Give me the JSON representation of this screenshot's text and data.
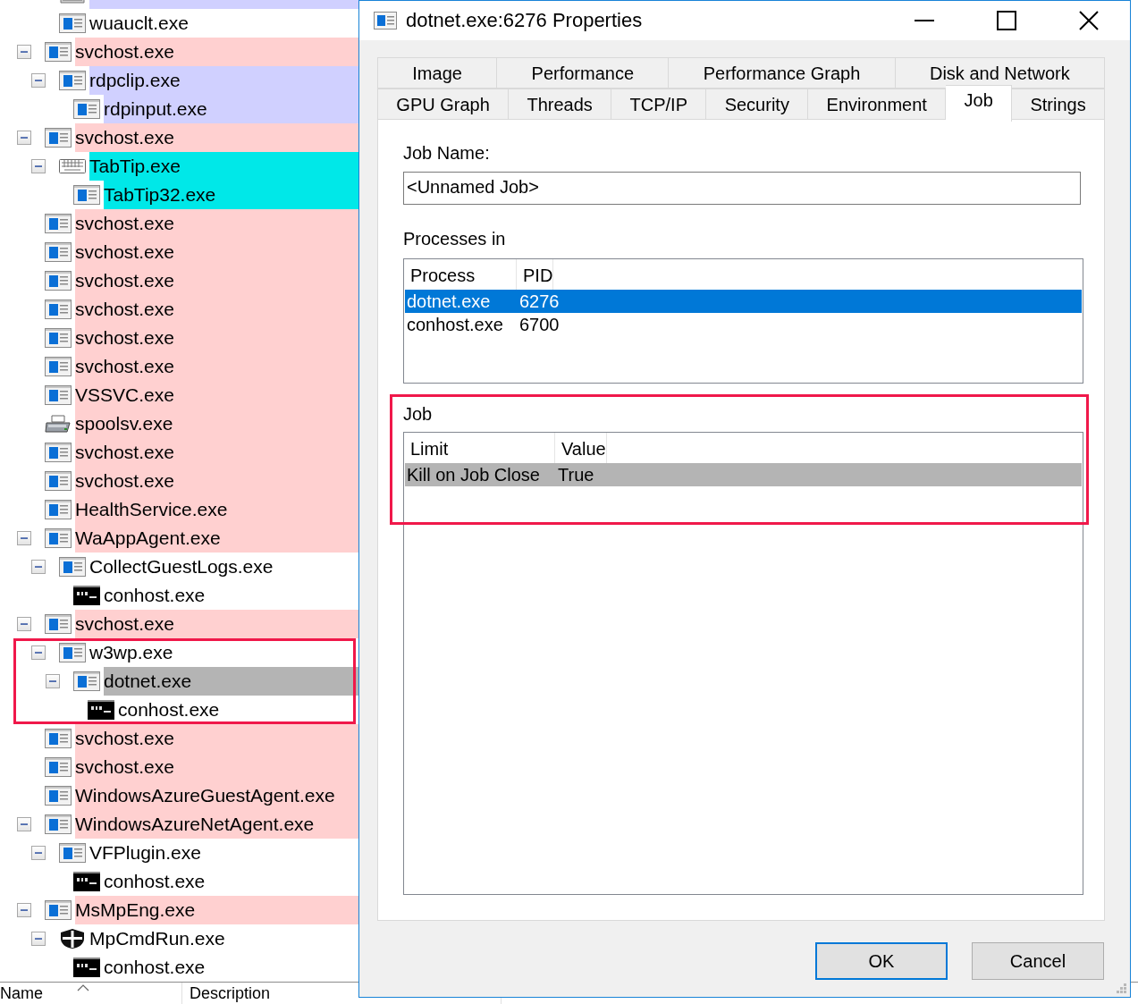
{
  "process_tree": [
    {
      "children": [
        {
          "kind": "drive",
          "color": "#d0d0ff",
          "selected": false
        },
        {
          "name": "wuauclt.exe",
          "kind": "window",
          "selected": false
        }
      ]
    },
    {
      "name": "svchost.exe",
      "kind": "window",
      "color": "#ffd0d0",
      "selected": false,
      "expanded": true,
      "children": [
        {
          "name": "rdpclip.exe",
          "kind": "window",
          "color": "#d0d0ff",
          "selected": false,
          "expanded": true,
          "children": [
            {
              "name": "rdpinput.exe",
              "kind": "window",
              "color": "#d0d0ff",
              "selected": false
            }
          ]
        }
      ]
    },
    {
      "name": "svchost.exe",
      "kind": "window",
      "color": "#ffd0d0",
      "selected": false,
      "expanded": true,
      "children": [
        {
          "name": "TabTip.exe",
          "kind": "keyboard",
          "color": "#00e8e8",
          "selected": false,
          "expanded": true,
          "children": [
            {
              "name": "TabTip32.exe",
              "kind": "window",
              "color": "#00e8e8",
              "selected": false
            }
          ]
        }
      ]
    },
    {
      "name": "svchost.exe",
      "kind": "window",
      "color": "#ffd0d0",
      "selected": false
    },
    {
      "name": "svchost.exe",
      "kind": "window",
      "color": "#ffd0d0",
      "selected": false
    },
    {
      "name": "svchost.exe",
      "kind": "window",
      "color": "#ffd0d0",
      "selected": false
    },
    {
      "name": "svchost.exe",
      "kind": "window",
      "color": "#ffd0d0",
      "selected": false
    },
    {
      "name": "svchost.exe",
      "kind": "window",
      "color": "#ffd0d0",
      "selected": false
    },
    {
      "name": "svchost.exe",
      "kind": "window",
      "color": "#ffd0d0",
      "selected": false
    },
    {
      "name": "VSSVC.exe",
      "kind": "window",
      "color": "#ffd0d0",
      "selected": false
    },
    {
      "name": "spoolsv.exe",
      "kind": "printer",
      "color": "#ffd0d0",
      "selected": false
    },
    {
      "name": "svchost.exe",
      "kind": "window",
      "color": "#ffd0d0",
      "selected": false
    },
    {
      "name": "svchost.exe",
      "kind": "window",
      "color": "#ffd0d0",
      "selected": false
    },
    {
      "name": "HealthService.exe",
      "kind": "window",
      "color": "#ffd0d0",
      "selected": false
    },
    {
      "name": "WaAppAgent.exe",
      "kind": "window",
      "color": "#ffd0d0",
      "selected": false,
      "expanded": true,
      "children": [
        {
          "name": "CollectGuestLogs.exe",
          "kind": "window",
          "selected": false,
          "expanded": true,
          "children": [
            {
              "name": "conhost.exe",
              "kind": "console",
              "selected": false
            }
          ]
        }
      ]
    },
    {
      "name": "svchost.exe",
      "kind": "window",
      "color": "#ffd0d0",
      "selected": false,
      "expanded": true,
      "children": [
        {
          "name": "w3wp.exe",
          "kind": "window",
          "selected": false,
          "expanded": true,
          "highlighted": true,
          "children": [
            {
              "name": "dotnet.exe",
              "kind": "window",
              "selected": true,
              "expanded": true,
              "children": [
                {
                  "name": "conhost.exe",
                  "kind": "console",
                  "selected": false
                }
              ]
            }
          ]
        }
      ]
    },
    {
      "name": "svchost.exe",
      "kind": "window",
      "color": "#ffd0d0",
      "selected": false
    },
    {
      "name": "svchost.exe",
      "kind": "window",
      "color": "#ffd0d0",
      "selected": false
    },
    {
      "name": "WindowsAzureGuestAgent.exe",
      "kind": "window",
      "color": "#ffd0d0",
      "selected": false
    },
    {
      "name": "WindowsAzureNetAgent.exe",
      "kind": "window",
      "color": "#ffd0d0",
      "selected": false,
      "expanded": true,
      "children": [
        {
          "name": "VFPlugin.exe",
          "kind": "window",
          "selected": false,
          "expanded": true,
          "children": [
            {
              "name": "conhost.exe",
              "kind": "console",
              "selected": false
            }
          ]
        }
      ]
    },
    {
      "name": "MsMpEng.exe",
      "kind": "window",
      "color": "#ffd0d0",
      "selected": false,
      "expanded": true,
      "children": [
        {
          "name": "MpCmdRun.exe",
          "kind": "shield",
          "selected": false,
          "expanded": true,
          "children": [
            {
              "name": "conhost.exe",
              "kind": "console",
              "selected": false
            }
          ]
        }
      ]
    }
  ],
  "columns": [
    {
      "label": "Name",
      "sorted": true
    },
    {
      "label": "Description",
      "sorted": false
    }
  ],
  "dialog": {
    "title": "dotnet.exe:6276 Properties",
    "tab_rows": [
      [
        {
          "label": "Image",
          "selected": false
        },
        {
          "label": "Performance",
          "selected": false
        },
        {
          "label": "Performance Graph",
          "selected": false
        },
        {
          "label": "Disk and Network",
          "selected": false
        }
      ],
      [
        {
          "label": "GPU Graph",
          "selected": false
        },
        {
          "label": "Threads",
          "selected": false
        },
        {
          "label": "TCP/IP",
          "selected": false
        },
        {
          "label": "Security",
          "selected": false
        },
        {
          "label": "Environment",
          "selected": false
        },
        {
          "label": "Job",
          "selected": true
        },
        {
          "label": "Strings",
          "selected": false
        }
      ]
    ],
    "job_name_label": "Job Name:",
    "job_name": "<Unnamed Job>",
    "processes": {
      "label": "Processes in",
      "focused": true,
      "columns": [
        "Process",
        "PID"
      ],
      "rows": [
        {
          "cells": [
            "dotnet.exe",
            "6276"
          ],
          "selected": true
        },
        {
          "cells": [
            "conhost.exe",
            "6700"
          ],
          "selected": false
        }
      ]
    },
    "job": {
      "label": "Job",
      "highlighted": true,
      "focused": false,
      "columns": [
        "Limit",
        "Value"
      ],
      "rows": [
        {
          "cells": [
            "Kill on Job Close",
            "True"
          ],
          "selected": true
        }
      ]
    },
    "buttons": [
      {
        "label": "OK",
        "default": true
      },
      {
        "label": "Cancel",
        "default": false
      }
    ]
  }
}
